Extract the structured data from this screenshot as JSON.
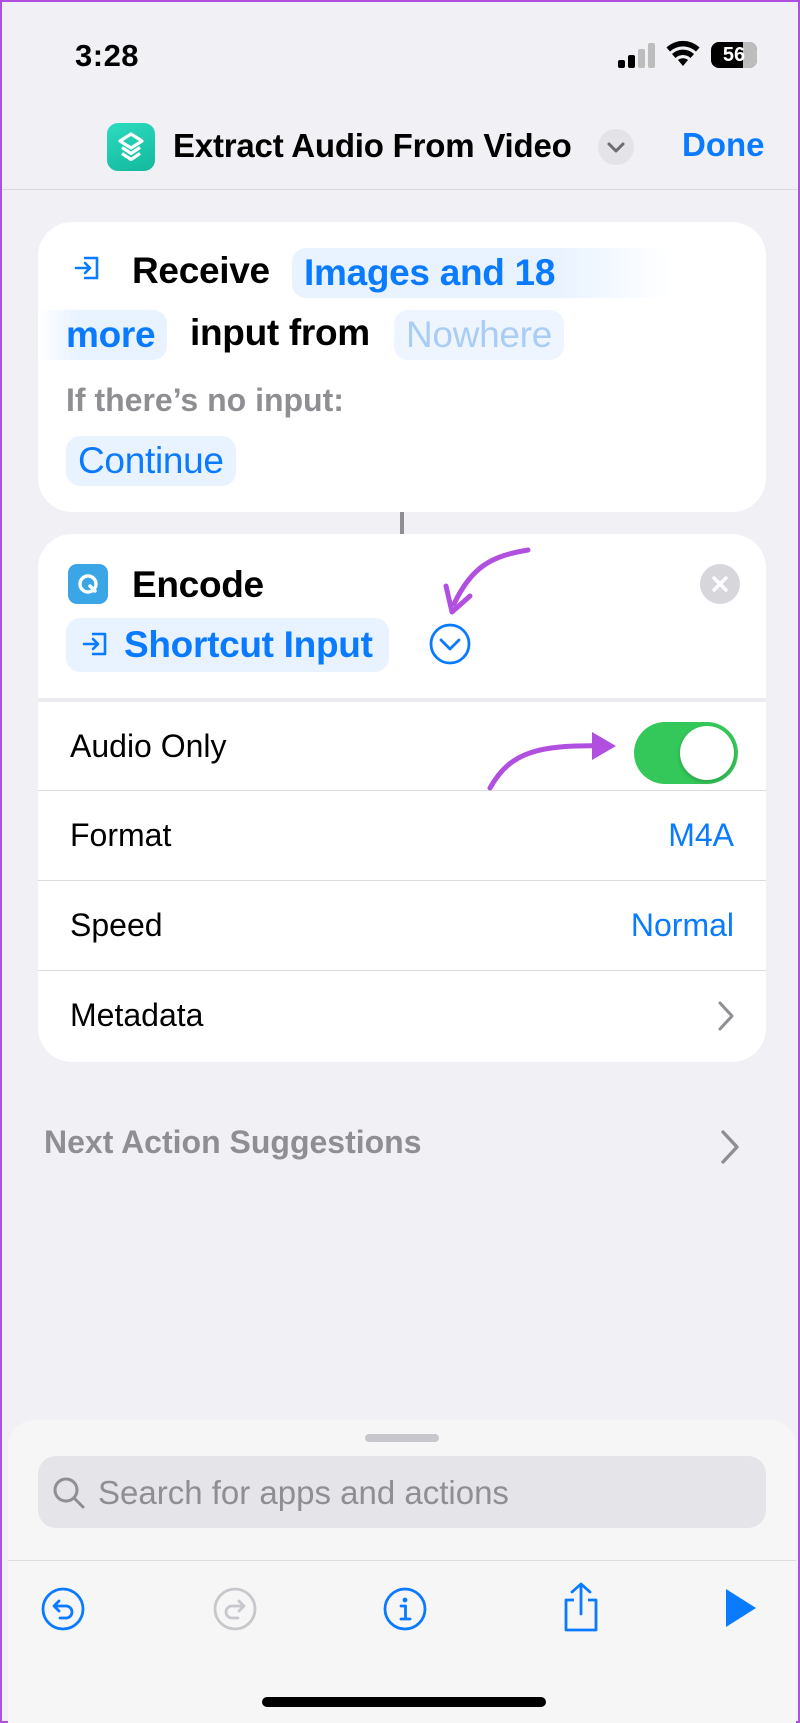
{
  "status_bar": {
    "time": "3:28",
    "battery": "56"
  },
  "nav": {
    "title": "Extract Audio From Video",
    "done_label": "Done",
    "app_icon": "shortcuts-icon"
  },
  "receive_action": {
    "verb": "Receive",
    "input_types_part1": "Images and 18",
    "input_types_part2": "more",
    "from_label": "input from",
    "source": "Nowhere",
    "no_input_label": "If there’s no input:",
    "no_input_value": "Continue"
  },
  "encode_action": {
    "title": "Encode",
    "input": "Shortcut Input",
    "rows": [
      {
        "label": "Audio Only",
        "toggle": true
      },
      {
        "label": "Format",
        "value": "M4A"
      },
      {
        "label": "Speed",
        "value": "Normal"
      },
      {
        "label": "Metadata"
      }
    ]
  },
  "suggestions": {
    "label": "Next Action Suggestions"
  },
  "sheet": {
    "search_placeholder": "Search for apps and actions",
    "toolbar": [
      "undo-icon",
      "redo-icon",
      "info-icon",
      "share-icon",
      "play-icon"
    ]
  },
  "colors": {
    "accent": "#0a7aff",
    "toggle_on": "#34c759",
    "annotation": "#b14fe0",
    "app_icon": "#1fc8ab"
  }
}
